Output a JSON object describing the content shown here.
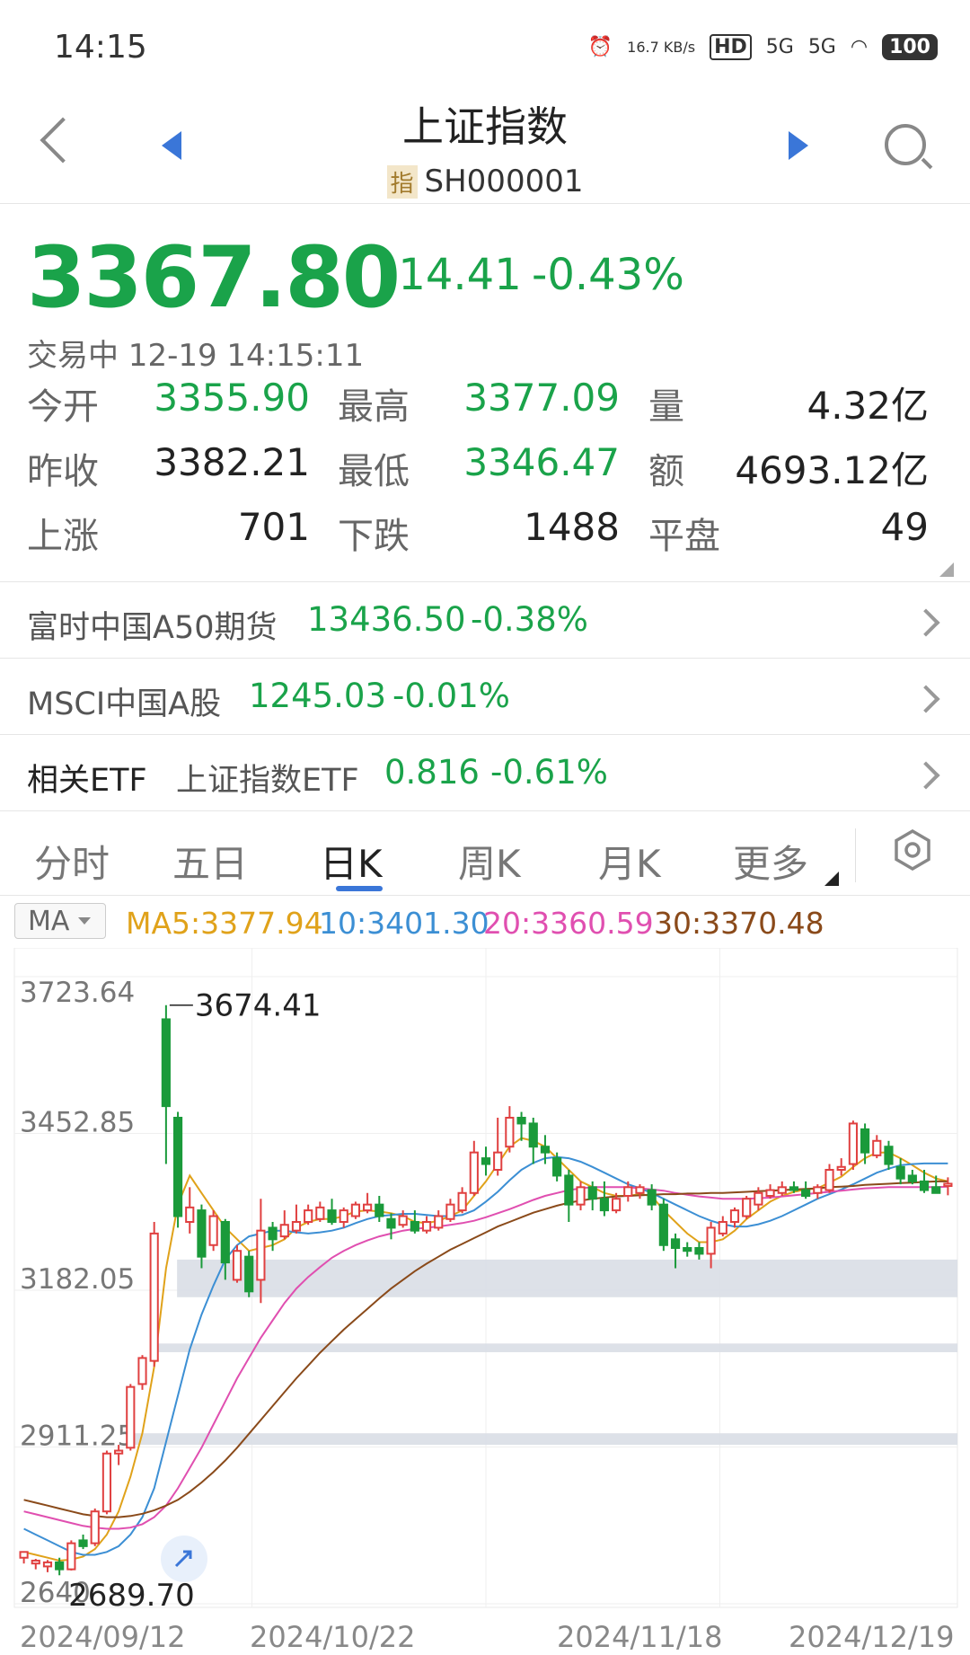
{
  "status_bar": {
    "time": "14:15",
    "net_speed": "16.7 KB/s",
    "hd": "HD",
    "signal1": "5G",
    "signal2": "5G",
    "battery": "100"
  },
  "header": {
    "title": "上证指数",
    "code_tag": "指",
    "code": "SH000001"
  },
  "quote": {
    "price": "3367.80",
    "change": "-14.41",
    "change_pct": "-0.43%",
    "status_time": "交易中 12-19 14:15:11"
  },
  "stats": [
    {
      "label": "今开",
      "value": "3355.90",
      "color": "#1aa34a"
    },
    {
      "label": "最高",
      "value": "3377.09",
      "color": "#1aa34a"
    },
    {
      "label": "量",
      "value": "4.32亿",
      "color": "#222222"
    },
    {
      "label": "昨收",
      "value": "3382.21",
      "color": "#222222"
    },
    {
      "label": "最低",
      "value": "3346.47",
      "color": "#1aa34a"
    },
    {
      "label": "额",
      "value": "4693.12亿",
      "color": "#222222"
    },
    {
      "label": "上涨",
      "value": "701",
      "color": "#222222"
    },
    {
      "label": "下跌",
      "value": "1488",
      "color": "#222222"
    },
    {
      "label": "平盘",
      "value": "49",
      "color": "#222222"
    }
  ],
  "rows": [
    {
      "label": "富时中国A50期货",
      "value": "13436.50",
      "pct": "-0.38%"
    },
    {
      "label": "MSCI中国A股",
      "value": "1245.03",
      "pct": "-0.01%"
    },
    {
      "label": "相关ETF",
      "sublabel": "上证指数ETF",
      "value": "0.816",
      "pct": "-0.61%"
    }
  ],
  "tabs": [
    "分时",
    "五日",
    "日K",
    "周K",
    "月K",
    "更多"
  ],
  "active_tab": "日K",
  "ma": {
    "selector": "MA",
    "items": [
      {
        "text": "MA5:3377.94",
        "color": "#e0a21a"
      },
      {
        "text": "10:3401.30",
        "color": "#3c8fd4"
      },
      {
        "text": "20:3360.59",
        "color": "#e04fb0"
      },
      {
        "text": "30:3370.48",
        "color": "#8a4a1a"
      }
    ]
  },
  "chart_data": {
    "type": "candlestick",
    "y_ticks": [
      "3723.64",
      "3452.85",
      "3182.05",
      "2911.25",
      "2640"
    ],
    "x_ticks": [
      "2024/09/12",
      "2024/10/22",
      "2024/11/18",
      "2024/12/19"
    ],
    "ylim": [
      2640.46,
      3723.64
    ],
    "max_label": "3674.41",
    "min_label": "2689.70",
    "candles": [
      [
        2720,
        2730,
        2730,
        2710
      ],
      [
        2710,
        2715,
        2718,
        2700
      ],
      [
        2705,
        2712,
        2716,
        2695
      ],
      [
        2712,
        2700,
        2720,
        2689.7
      ],
      [
        2700,
        2745,
        2750,
        2698
      ],
      [
        2750,
        2740,
        2760,
        2735
      ],
      [
        2745,
        2800,
        2805,
        2740
      ],
      [
        2800,
        2900,
        2905,
        2795
      ],
      [
        2900,
        2905,
        2915,
        2880
      ],
      [
        2910,
        3015,
        3020,
        2905
      ],
      [
        3020,
        3065,
        3070,
        3010
      ],
      [
        3060,
        3280,
        3300,
        3050
      ],
      [
        3650,
        3500,
        3674.41,
        3400
      ],
      [
        3480,
        3310,
        3490,
        3290
      ],
      [
        3300,
        3325,
        3360,
        3280
      ],
      [
        3320,
        3240,
        3330,
        3220
      ],
      [
        3260,
        3310,
        3320,
        3250
      ],
      [
        3300,
        3230,
        3305,
        3200
      ],
      [
        3200,
        3250,
        3260,
        3195
      ],
      [
        3240,
        3180,
        3250,
        3170
      ],
      [
        3200,
        3285,
        3340,
        3160
      ],
      [
        3290,
        3270,
        3300,
        3250
      ],
      [
        3275,
        3295,
        3320,
        3270
      ],
      [
        3285,
        3300,
        3330,
        3280
      ],
      [
        3300,
        3320,
        3330,
        3295
      ],
      [
        3305,
        3325,
        3335,
        3300
      ],
      [
        3320,
        3300,
        3340,
        3295
      ],
      [
        3300,
        3320,
        3325,
        3290
      ],
      [
        3310,
        3330,
        3335,
        3305
      ],
      [
        3320,
        3330,
        3350,
        3315
      ],
      [
        3330,
        3310,
        3345,
        3300
      ],
      [
        3305,
        3290,
        3315,
        3270
      ],
      [
        3295,
        3310,
        3320,
        3290
      ],
      [
        3300,
        3285,
        3320,
        3280
      ],
      [
        3285,
        3300,
        3310,
        3280
      ],
      [
        3290,
        3310,
        3320,
        3285
      ],
      [
        3305,
        3330,
        3340,
        3300
      ],
      [
        3320,
        3350,
        3360,
        3315
      ],
      [
        3350,
        3420,
        3440,
        3345
      ],
      [
        3410,
        3400,
        3430,
        3380
      ],
      [
        3390,
        3420,
        3480,
        3380
      ],
      [
        3430,
        3480,
        3500,
        3420
      ],
      [
        3480,
        3470,
        3490,
        3440
      ],
      [
        3470,
        3430,
        3480,
        3400
      ],
      [
        3430,
        3420,
        3450,
        3400
      ],
      [
        3410,
        3380,
        3420,
        3370
      ],
      [
        3380,
        3330,
        3390,
        3300
      ],
      [
        3330,
        3360,
        3370,
        3320
      ],
      [
        3360,
        3340,
        3370,
        3320
      ],
      [
        3340,
        3320,
        3370,
        3310
      ],
      [
        3320,
        3340,
        3350,
        3315
      ],
      [
        3345,
        3360,
        3370,
        3335
      ],
      [
        3350,
        3360,
        3365,
        3340
      ],
      [
        3355,
        3330,
        3365,
        3320
      ],
      [
        3330,
        3260,
        3340,
        3250
      ],
      [
        3270,
        3255,
        3280,
        3220
      ],
      [
        3255,
        3250,
        3265,
        3240
      ],
      [
        3255,
        3245,
        3265,
        3235
      ],
      [
        3245,
        3290,
        3300,
        3220
      ],
      [
        3280,
        3300,
        3310,
        3275
      ],
      [
        3300,
        3320,
        3325,
        3290
      ],
      [
        3310,
        3340,
        3345,
        3305
      ],
      [
        3330,
        3350,
        3360,
        3320
      ],
      [
        3345,
        3355,
        3365,
        3340
      ],
      [
        3350,
        3360,
        3370,
        3345
      ],
      [
        3360,
        3355,
        3370,
        3350
      ],
      [
        3355,
        3345,
        3370,
        3340
      ],
      [
        3350,
        3360,
        3365,
        3340
      ],
      [
        3355,
        3390,
        3400,
        3350
      ],
      [
        3390,
        3395,
        3410,
        3380
      ],
      [
        3400,
        3470,
        3475,
        3390
      ],
      [
        3460,
        3420,
        3470,
        3400
      ],
      [
        3415,
        3440,
        3450,
        3410
      ],
      [
        3430,
        3400,
        3440,
        3390
      ],
      [
        3395,
        3375,
        3410,
        3365
      ],
      [
        3380,
        3370,
        3390,
        3365
      ],
      [
        3370,
        3355,
        3390,
        3350
      ],
      [
        3360,
        3350,
        3380,
        3350
      ],
      [
        3362,
        3366,
        3377,
        3346
      ]
    ],
    "ma_lines": {
      "ma5": [
        2730,
        2725,
        2720,
        2715,
        2717,
        2722,
        2735,
        2760,
        2800,
        2860,
        2935,
        3050,
        3220,
        3330,
        3380,
        3350,
        3320,
        3290,
        3270,
        3250,
        3255,
        3260,
        3270,
        3290,
        3300,
        3305,
        3305,
        3310,
        3318,
        3320,
        3318,
        3315,
        3310,
        3300,
        3298,
        3302,
        3310,
        3320,
        3345,
        3370,
        3400,
        3430,
        3445,
        3440,
        3430,
        3410,
        3390,
        3370,
        3360,
        3350,
        3345,
        3345,
        3348,
        3345,
        3320,
        3300,
        3280,
        3265,
        3265,
        3270,
        3285,
        3305,
        3320,
        3335,
        3345,
        3352,
        3356,
        3358,
        3368,
        3378,
        3395,
        3410,
        3420,
        3420,
        3410,
        3398,
        3385,
        3375,
        3370
      ],
      "ma10": [
        2770,
        2760,
        2750,
        2740,
        2730,
        2725,
        2725,
        2730,
        2740,
        2760,
        2790,
        2840,
        2920,
        3000,
        3080,
        3140,
        3190,
        3235,
        3260,
        3275,
        3280,
        3285,
        3285,
        3282,
        3280,
        3282,
        3285,
        3290,
        3298,
        3305,
        3310,
        3312,
        3314,
        3314,
        3312,
        3310,
        3310,
        3312,
        3320,
        3335,
        3352,
        3372,
        3390,
        3402,
        3410,
        3412,
        3410,
        3404,
        3395,
        3385,
        3375,
        3365,
        3358,
        3350,
        3340,
        3330,
        3320,
        3310,
        3302,
        3296,
        3292,
        3292,
        3296,
        3302,
        3310,
        3320,
        3330,
        3340,
        3348,
        3356,
        3365,
        3375,
        3385,
        3392,
        3398,
        3400,
        3401,
        3401,
        3401
      ],
      "ma20": [
        2800,
        2795,
        2790,
        2785,
        2780,
        2775,
        2772,
        2770,
        2770,
        2772,
        2778,
        2790,
        2810,
        2840,
        2875,
        2910,
        2950,
        2990,
        3030,
        3065,
        3100,
        3130,
        3160,
        3185,
        3205,
        3222,
        3238,
        3250,
        3260,
        3268,
        3275,
        3280,
        3285,
        3288,
        3290,
        3292,
        3295,
        3298,
        3302,
        3308,
        3315,
        3322,
        3330,
        3338,
        3345,
        3350,
        3355,
        3358,
        3360,
        3360,
        3360,
        3360,
        3358,
        3356,
        3354,
        3350,
        3347,
        3344,
        3342,
        3340,
        3340,
        3340,
        3341,
        3342,
        3344,
        3346,
        3348,
        3350,
        3352,
        3354,
        3356,
        3358,
        3359,
        3360,
        3360,
        3360,
        3360,
        3360,
        3361
      ],
      "ma30": [
        2820,
        2815,
        2810,
        2805,
        2800,
        2795,
        2792,
        2790,
        2790,
        2792,
        2796,
        2802,
        2810,
        2820,
        2834,
        2850,
        2868,
        2888,
        2910,
        2934,
        2958,
        2982,
        3006,
        3030,
        3052,
        3074,
        3094,
        3114,
        3132,
        3150,
        3168,
        3185,
        3200,
        3215,
        3228,
        3240,
        3252,
        3262,
        3272,
        3282,
        3292,
        3300,
        3308,
        3316,
        3322,
        3328,
        3333,
        3337,
        3340,
        3342,
        3344,
        3345,
        3346,
        3347,
        3348,
        3348,
        3349,
        3349,
        3350,
        3350,
        3351,
        3352,
        3353,
        3354,
        3355,
        3356,
        3357,
        3358,
        3360,
        3361,
        3362,
        3364,
        3365,
        3366,
        3367,
        3368,
        3369,
        3370,
        3370
      ]
    },
    "colors": {
      "up": "#e04040",
      "down": "#1a9a3a",
      "band": "#d9dee6"
    }
  }
}
